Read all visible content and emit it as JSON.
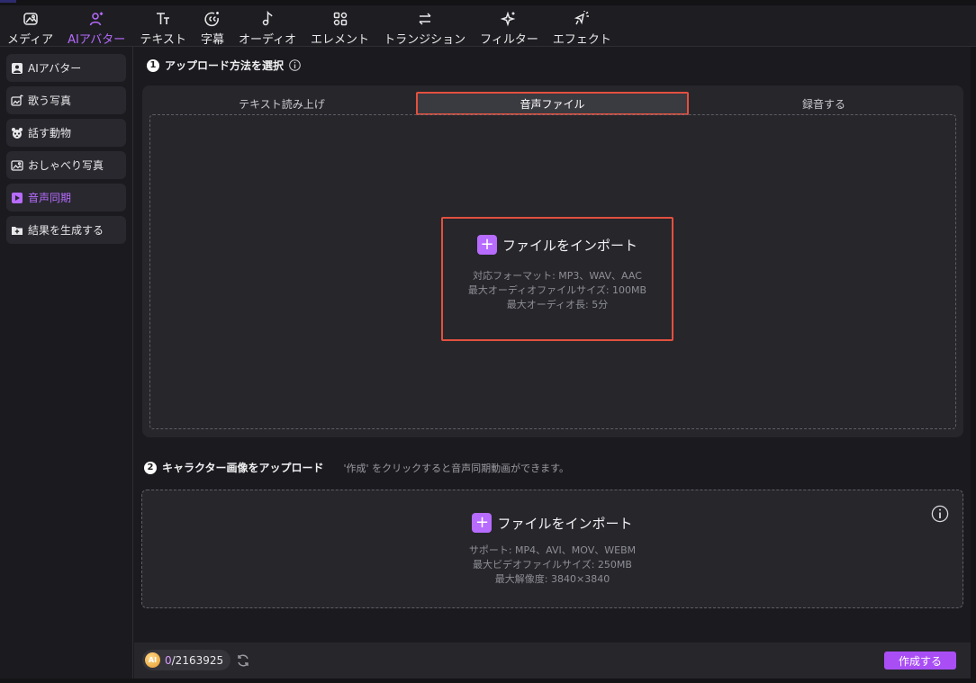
{
  "toolbar": {
    "items": [
      {
        "label": "メディア",
        "icon": "media-icon"
      },
      {
        "label": "AIアバター",
        "icon": "ai-avatar-icon",
        "active": true
      },
      {
        "label": "テキスト",
        "icon": "text-icon"
      },
      {
        "label": "字幕",
        "icon": "subtitle-icon"
      },
      {
        "label": "オーディオ",
        "icon": "audio-icon"
      },
      {
        "label": "エレメント",
        "icon": "element-icon"
      },
      {
        "label": "トランジション",
        "icon": "transition-icon"
      },
      {
        "label": "フィルター",
        "icon": "filter-icon"
      },
      {
        "label": "エフェクト",
        "icon": "effect-icon"
      }
    ]
  },
  "sidebar": {
    "items": [
      {
        "label": "AIアバター",
        "icon": "avatar-icon"
      },
      {
        "label": "歌う写真",
        "icon": "singing-photo-icon"
      },
      {
        "label": "話す動物",
        "icon": "talking-animal-icon"
      },
      {
        "label": "おしゃべり写真",
        "icon": "talking-photo-icon"
      },
      {
        "label": "音声同期",
        "icon": "lip-sync-icon",
        "active": true
      },
      {
        "label": "結果を生成する",
        "icon": "generate-result-icon"
      }
    ]
  },
  "step1": {
    "number": "1",
    "title": "アップロード方法を選択",
    "tabs": [
      {
        "label": "テキスト読み上げ"
      },
      {
        "label": "音声ファイル",
        "selected": true
      },
      {
        "label": "録音する"
      }
    ],
    "import_label": "ファイルをインポート",
    "specs": [
      "対応フォーマット: MP3、WAV、AAC",
      "最大オーディオファイルサイズ: 100MB",
      "最大オーディオ長: 5分"
    ]
  },
  "step2": {
    "number": "2",
    "title": "キャラクター画像をアップロード",
    "hint": "'作成' をクリックすると音声同期動画ができます。",
    "import_label": "ファイルをインポート",
    "specs": [
      "サポート: MP4、AVI、MOV、WEBM",
      "最大ビデオファイルサイズ: 250MB",
      "最大解像度:  3840×3840"
    ]
  },
  "footer": {
    "coin_label": "AI",
    "credits_used": "0",
    "credits_total": "/2163925",
    "create_label": "作成する"
  },
  "colors": {
    "accent": "#b76bff",
    "button": "#a94ef5",
    "highlight": "#e3503f"
  }
}
